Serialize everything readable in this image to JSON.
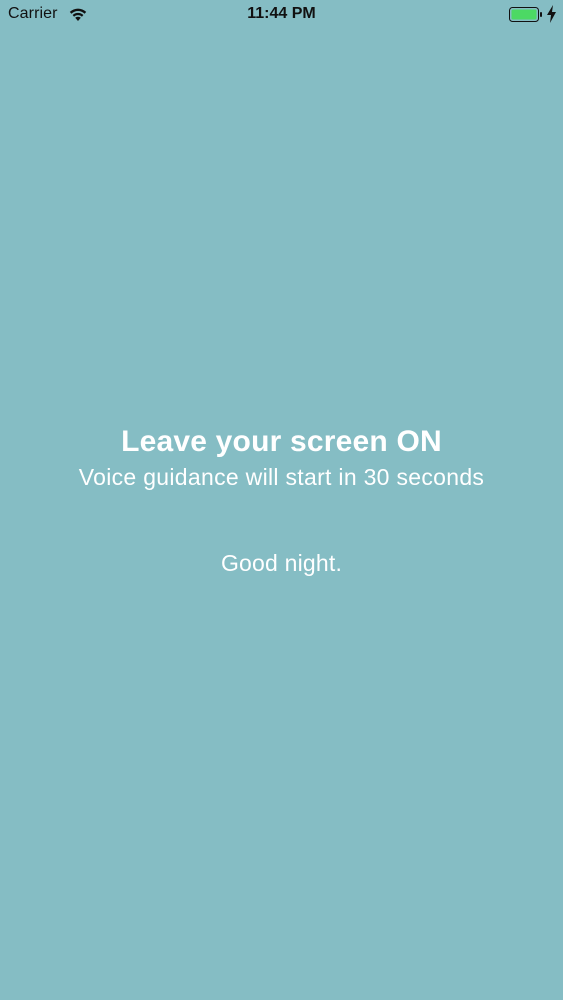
{
  "status_bar": {
    "carrier": "Carrier",
    "time": "11:44 PM",
    "battery_color": "#4cd964"
  },
  "main": {
    "background_color": "#85bdc4",
    "headline": "Leave your screen ON",
    "subline": "Voice guidance will start in 30 seconds",
    "farewell": "Good night."
  }
}
